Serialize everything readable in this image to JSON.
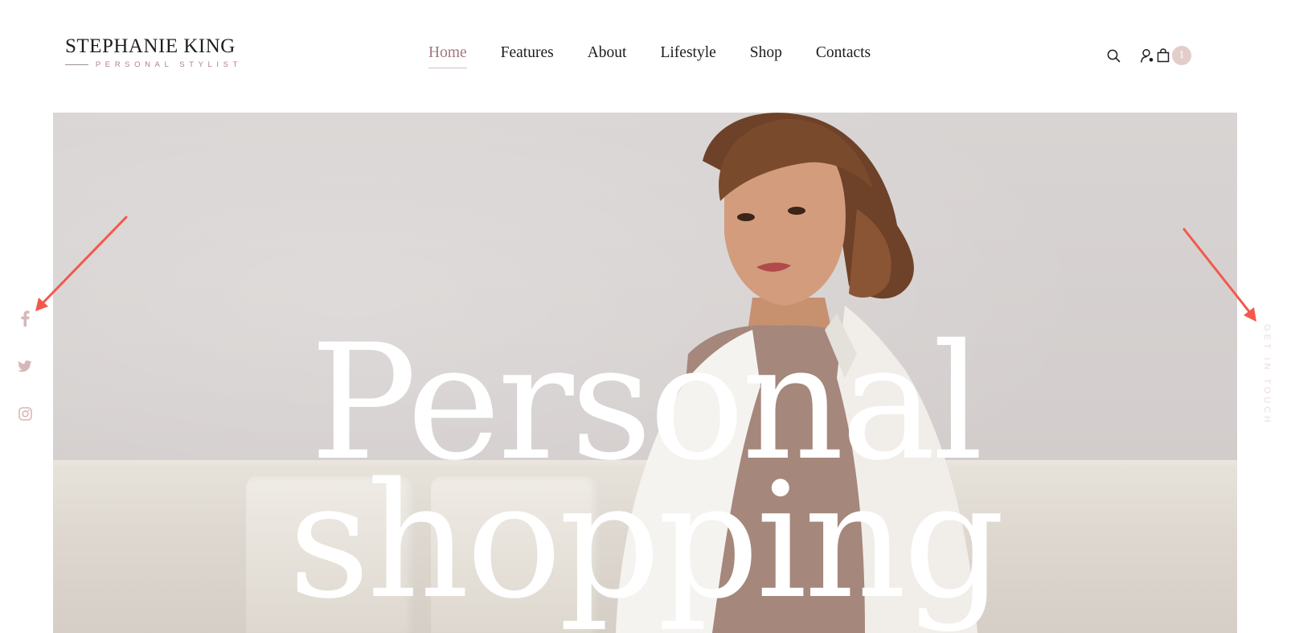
{
  "brand": {
    "name": "STEPHANIE KING",
    "tagline": "PERSONAL STYLIST"
  },
  "nav": {
    "items": [
      {
        "label": "Home",
        "active": true
      },
      {
        "label": "Features",
        "active": false
      },
      {
        "label": "About",
        "active": false
      },
      {
        "label": "Lifestyle",
        "active": false
      },
      {
        "label": "Shop",
        "active": false
      },
      {
        "label": "Contacts",
        "active": false
      }
    ]
  },
  "header_icons": {
    "search": "search-icon",
    "account": "user-icon",
    "cart": "shopping-bag-icon",
    "cart_count": "1"
  },
  "hero": {
    "title_line1": "Personal",
    "title_line2": "shopping"
  },
  "social": [
    "facebook-icon",
    "twitter-icon",
    "instagram-icon"
  ],
  "side_link": "GET IN TOUCH",
  "colors": {
    "accent": "#a27880",
    "tagline": "#b37f86",
    "badge": "#e2cdcb",
    "social_icon": "#d6b8b7",
    "annotation_arrow": "#f2594b"
  }
}
